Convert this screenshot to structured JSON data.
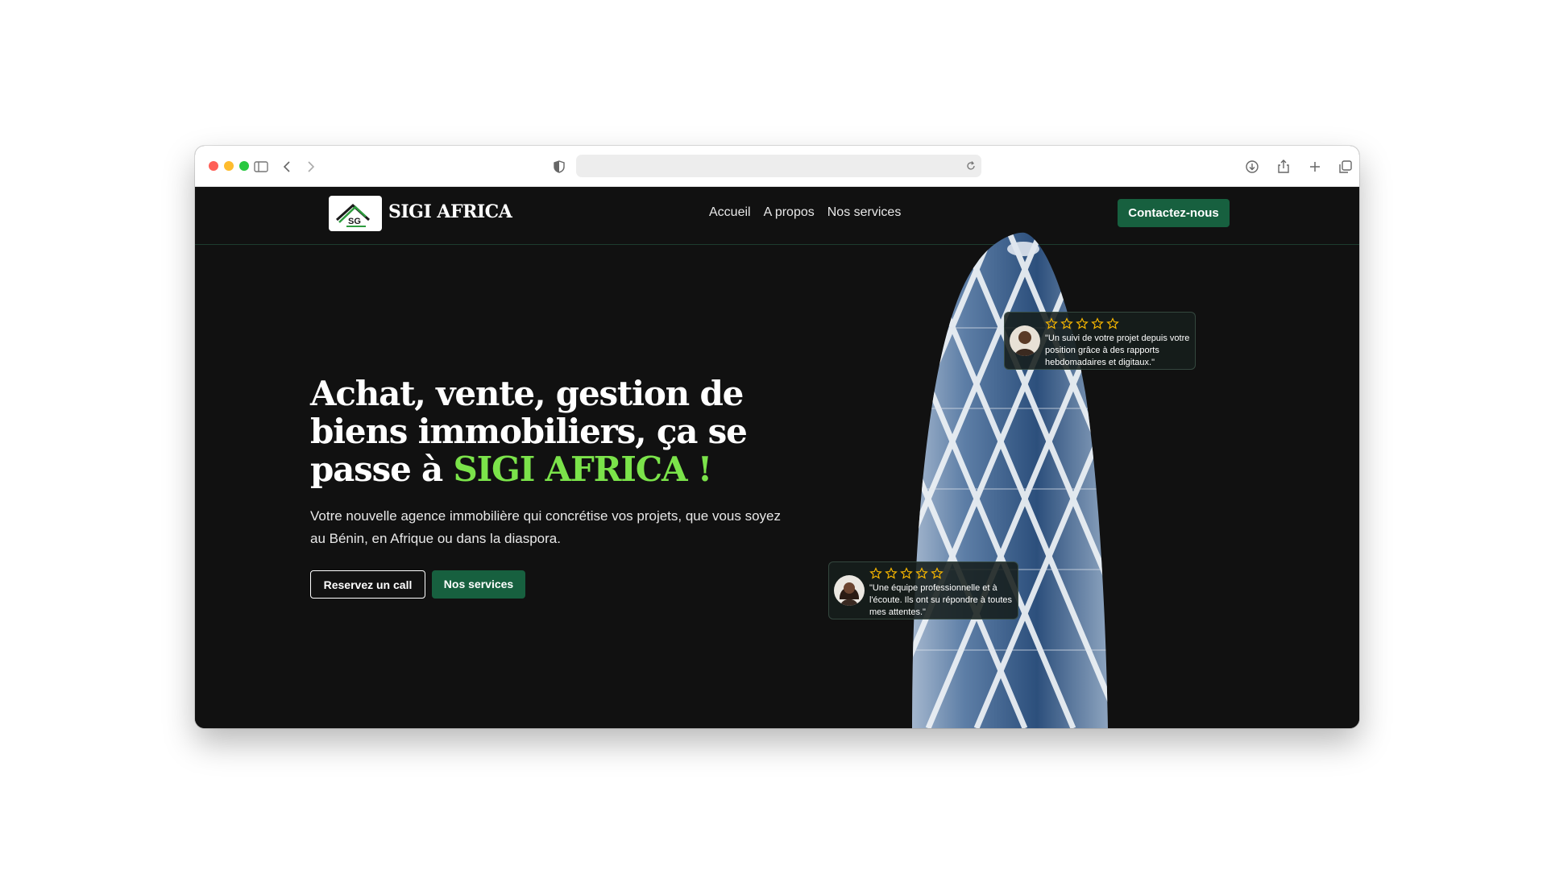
{
  "browser": {
    "address_value": ""
  },
  "site": {
    "brand": "SIGI AFRICA",
    "nav": {
      "home": "Accueil",
      "about": "A propos",
      "services": "Nos services",
      "contact": "Contactez-nous"
    },
    "hero": {
      "title_part1": "Achat, vente, gestion de biens immobiliers, ça se passe à ",
      "title_accent": "SIGI AFRICA !",
      "subtitle": "Votre nouvelle agence immobilière qui concrétise vos projets, que vous soyez au Bénin, en Afrique ou dans la diaspora.",
      "cta_call": "Reservez un call",
      "cta_services": "Nos services"
    },
    "reviews": [
      {
        "rating": 5,
        "text": "\"Un suivi de votre projet depuis votre position grâce à des rapports hebdomadaires et digitaux.\""
      },
      {
        "rating": 5,
        "text": "\"Une équipe professionnelle et à l'écoute. Ils ont su répondre à toutes mes attentes.\""
      }
    ]
  },
  "colors": {
    "accent_green": "#7be34a",
    "brand_green": "#17603f",
    "star_gold": "#f4b400",
    "background": "#111111"
  },
  "icons": {
    "chrome": [
      "sidebar-icon",
      "back-icon",
      "forward-icon",
      "shield-icon",
      "reload-icon",
      "download-icon",
      "share-icon",
      "new-tab-icon",
      "tabs-overview-icon"
    ],
    "review": [
      "star-icon",
      "avatar"
    ]
  }
}
